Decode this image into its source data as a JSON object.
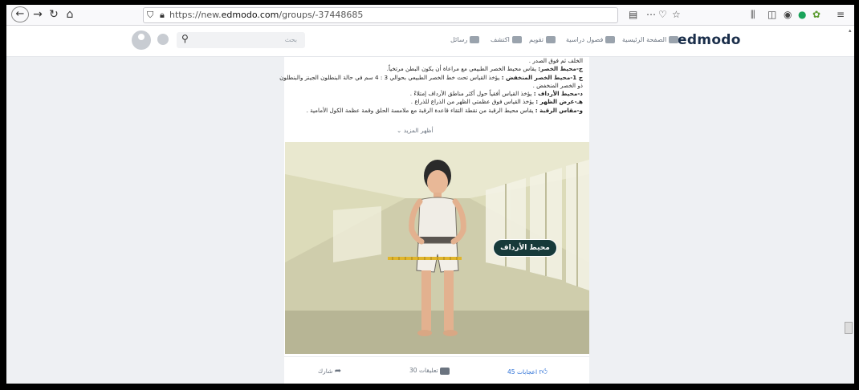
{
  "browser": {
    "url_prefix": "https://new.",
    "url_host": "edmodo.com",
    "url_path": "/groups/-37448685",
    "nav": {
      "back": "←",
      "forward": "→",
      "reload": "↻",
      "home": "⌂"
    },
    "icons": [
      "reader-view-icon",
      "more-icon",
      "pocket-icon",
      "bookmark-star-icon",
      "library-icon",
      "sidebar-icon",
      "account-icon",
      "extension-icon",
      "menu-icon"
    ]
  },
  "app": {
    "logo": "edmodo",
    "nav": {
      "home": "الصفحة الرئيسية",
      "classes": "فصول دراسية",
      "calendar": "تقويم",
      "discover": "اكتشف",
      "messages": "رسائل"
    },
    "search_placeholder": "بحث"
  },
  "post": {
    "lines": [
      {
        "bold": "",
        "text": "الخلف ثم فوق الصدر ."
      },
      {
        "bold": "ج-محيط الخصر:",
        "text": " يقاس محيط الخصر الطبيعي مع مراعاة أن يكون البطن مرتخياً."
      },
      {
        "bold": "ج 1-محيط الخصر المنخفض :",
        "text": " يؤخذ القياس تحت خط الخصر الطبيعي بحوالي 3 : 4 سم في حالة البنطلون الجينز والبنطلون"
      },
      {
        "bold": "",
        "text": "ذو الخصر المنخفض ."
      },
      {
        "bold": "د-محيط الأرداف :",
        "text": " يؤخذ القياس أفقياً حول أكثر مناطق الأرداف إمتلاءً ."
      },
      {
        "bold": "هـ-عرض الظهر :",
        "text": " يؤخذ القياس فوق عظمتي الظهر من الذراع للذراع ."
      },
      {
        "bold": "و-مقاس الرقبة :",
        "text": " يقاس محيط الرقبة من نقطة التقاء قاعدة الرقبة مع ملامسة الحلق وقمة عظمة الكول الأمامية ."
      }
    ],
    "show_more": "أظهر المزيد",
    "image_label": "محيط الأرداف",
    "likes": "45 اعجابات",
    "comments": "30 تعليقات",
    "share": "شارك"
  }
}
